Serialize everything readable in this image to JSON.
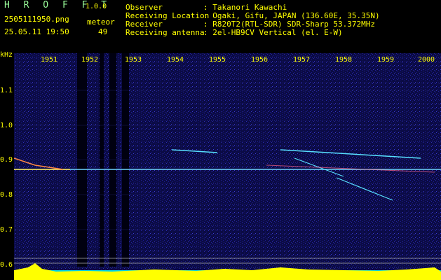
{
  "header": {
    "app_name": "H R O F F T",
    "version": "1.0.0",
    "filename": "2505111950.png",
    "datetime": "25.05.11 19:50",
    "meteor_label": "meteor",
    "meteor_count": "49",
    "observer_key": "Observer",
    "observer_val": ": Takanori Kawachi",
    "location_key": "Receiving Location",
    "location_val": ": Ogaki, Gifu, JAPAN (136.60E, 35.35N)",
    "receiver_key": "Receiver",
    "receiver_val": ": R820T2(RTL-SDR) SDR-Sharp 53.372MHz",
    "antenna_key": "Receiving antenna",
    "antenna_val": ": 2el-HB9CV Vertical (el. E-W)"
  },
  "axis": {
    "unit": "kHz",
    "y_ticks": [
      "1.1",
      "1.0",
      "0.9",
      "0.8",
      "0.7",
      "0.6"
    ],
    "x_ticks": [
      "1951",
      "1952",
      "1953",
      "1954",
      "1955",
      "1956",
      "1957",
      "1958",
      "1959",
      "2000"
    ]
  },
  "colors": {
    "background": "#000000",
    "spectrum": "#0a0a3a",
    "label": "#ffff00",
    "title": "#9cff9c",
    "carrier": "#6fd4ff"
  }
}
